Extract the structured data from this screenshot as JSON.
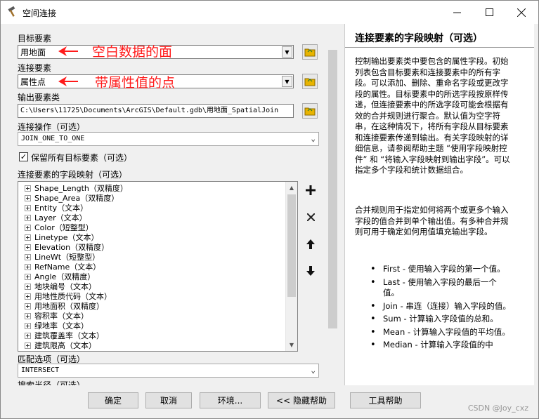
{
  "window": {
    "title": "空间连接"
  },
  "form": {
    "target_label": "目标要素",
    "target_value": "用地面",
    "join_label": "连接要素",
    "join_value": "属性点",
    "output_label": "输出要素类",
    "output_value": "C:\\Users\\11725\\Documents\\ArcGIS\\Default.gdb\\用地面_SpatialJoin",
    "operation_label": "连接操作（可选）",
    "operation_value": "JOIN_ONE_TO_ONE",
    "keep_all_label": "保留所有目标要素（可选）",
    "keep_all_checked": true,
    "field_map_label": "连接要素的字段映射（可选）",
    "match_label": "匹配选项（可选）",
    "match_value": "INTERSECT",
    "search_label": "搜索半径（可选）"
  },
  "annotations": {
    "target_note": "空白数据的面",
    "join_note": "带属性值的点"
  },
  "field_map": [
    "Shape_Length（双精度）",
    "Shape_Area（双精度）",
    "Entity（文本）",
    "Layer（文本）",
    "Color（短整型）",
    "Linetype（文本）",
    "Elevation（双精度）",
    "LineWt（短整型）",
    "RefName（文本）",
    "Angle（双精度）",
    "地块编号（文本）",
    "用地性质代码（文本）",
    "用地面积（双精度）",
    "容积率（文本）",
    "绿地率（文本）",
    "建筑覆盖率（文本）",
    "建筑限高（文本）"
  ],
  "help": {
    "title": "连接要素的字段映射（可选）",
    "para1": "控制输出要素类中要包含的属性字段。初始列表包含目标要素和连接要素中的所有字段。可以添加、删除、重命名字段或更改字段的属性。目标要素中的所选字段按原样传递，但连接要素中的所选字段可能会根据有效的合并规则进行聚合。默认值为空字符串，在这种情况下，将所有字段从目标要素和连接要素传递到输出。有关字段映射的详细信息，请参阅帮助主题 “使用字段映射控件” 和 “将输入字段映射到输出字段”。可以指定多个字段和统计数据组合。",
    "para2": "合并规则用于指定如何将两个或更多个输入字段的值合并到单个输出值。有多种合并规则可用于确定如何用值填充输出字段。",
    "bullets": [
      "First - 使用输入字段的第一个值。",
      "Last - 使用输入字段的最后一个值。",
      "Join - 串连（连接）输入字段的值。",
      "Sum - 计算输入字段值的总和。",
      "Mean - 计算输入字段值的平均值。",
      "Median - 计算输入字段值的中"
    ]
  },
  "buttons": {
    "ok": "确定",
    "cancel": "取消",
    "env": "环境...",
    "hide_help": "<< 隐藏帮助",
    "tool_help": "工具帮助"
  },
  "watermark": "CSDN @Joy_cxz",
  "colors": {
    "annotation": "#ff1a1a",
    "folder": "#e8b400"
  }
}
